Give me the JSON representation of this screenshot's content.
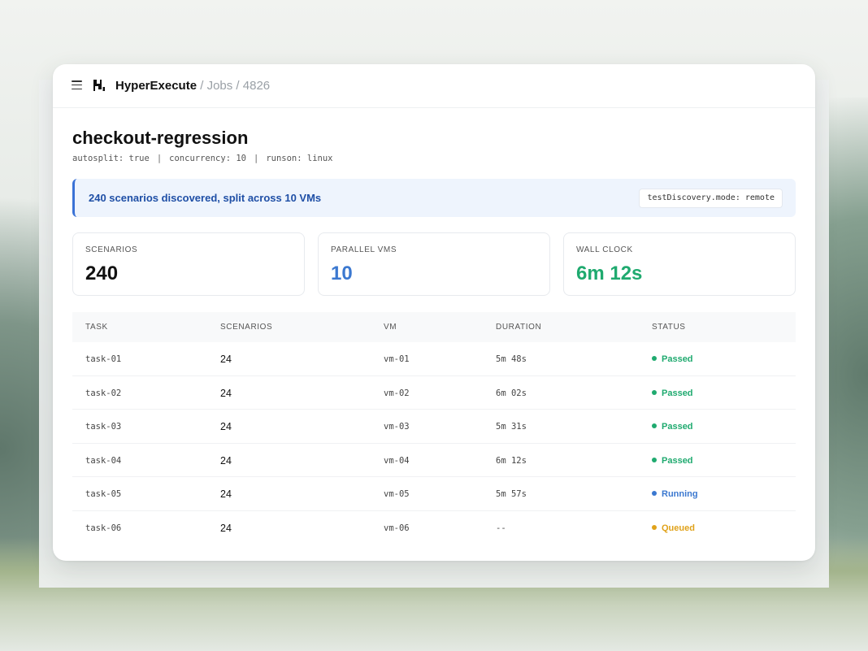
{
  "app": {
    "name": "HyperExecute",
    "breadcrumb_sep": " / ",
    "breadcrumbs": [
      "Jobs",
      "4826"
    ]
  },
  "job": {
    "title": "checkout-regression",
    "meta": [
      "autosplit: true",
      "concurrency: 10",
      "runson: linux"
    ],
    "meta_separator": "|"
  },
  "banner": {
    "text": "240 scenarios discovered, split across 10 VMs",
    "code": "testDiscovery.mode: remote"
  },
  "stats": [
    {
      "label": "SCENARIOS",
      "value": "240",
      "color": "#111111"
    },
    {
      "label": "PARALLEL VMS",
      "value": "10",
      "color": "#3b78d0"
    },
    {
      "label": "WALL CLOCK",
      "value": "6m 12s",
      "color": "#1faa6f"
    }
  ],
  "table": {
    "headers": [
      "TASK",
      "SCENARIOS",
      "VM",
      "DURATION",
      "STATUS"
    ],
    "rows": [
      {
        "task": "task-01",
        "scenarios": "24",
        "vm": "vm-01",
        "duration": "5m 48s",
        "status": "Passed"
      },
      {
        "task": "task-02",
        "scenarios": "24",
        "vm": "vm-02",
        "duration": "6m 02s",
        "status": "Passed"
      },
      {
        "task": "task-03",
        "scenarios": "24",
        "vm": "vm-03",
        "duration": "5m 31s",
        "status": "Passed"
      },
      {
        "task": "task-04",
        "scenarios": "24",
        "vm": "vm-04",
        "duration": "6m 12s",
        "status": "Passed"
      },
      {
        "task": "task-05",
        "scenarios": "24",
        "vm": "vm-05",
        "duration": "5m 57s",
        "status": "Running"
      },
      {
        "task": "task-06",
        "scenarios": "24",
        "vm": "vm-06",
        "duration": "--",
        "status": "Queued"
      }
    ]
  },
  "status_colors": {
    "Passed": "#1faa6f",
    "Running": "#3b78d0",
    "Queued": "#e0a21a"
  },
  "icons": {
    "menu": "menu-icon",
    "logo": "logo-icon"
  }
}
